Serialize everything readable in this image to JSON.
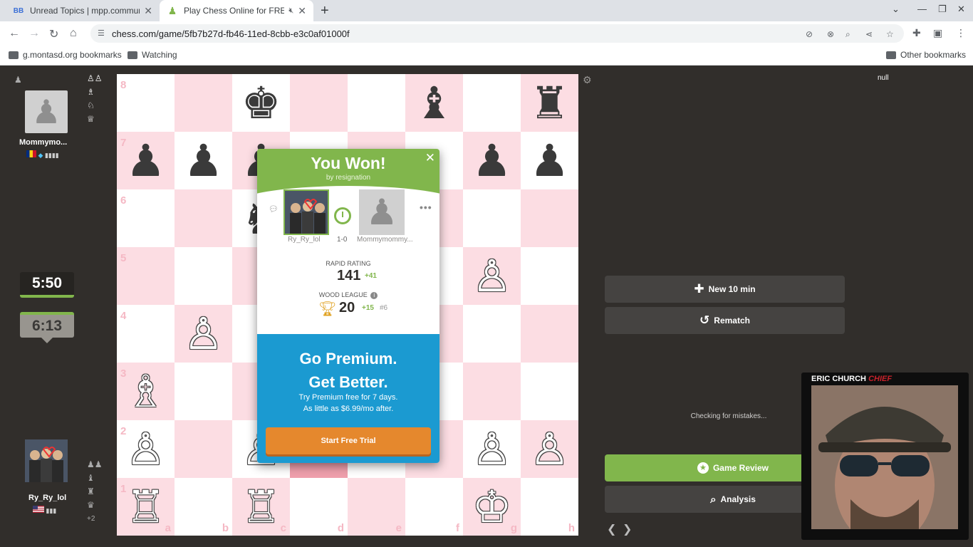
{
  "browser": {
    "tabs": [
      {
        "title": "Unread Topics | mpp.community",
        "favicon": "BB"
      },
      {
        "title": "Play Chess Online for FREE"
      }
    ],
    "url": "chess.com/game/5fb7b27d-fb46-11ed-8cbb-e3c0af01000f",
    "bookmarks": [
      "g.montasd.org bookmarks",
      "Watching"
    ],
    "other_bookmarks": "Other bookmarks"
  },
  "players": {
    "top": {
      "name": "Mommymo...",
      "clock": "5:50",
      "badges": "▮▮▮▮"
    },
    "bottom": {
      "name": "Ry_Ry_lol",
      "clock": "6:13",
      "captured_extra": "+2",
      "badges": "▮▮▮"
    }
  },
  "board": {
    "ranks": [
      "8",
      "7",
      "6",
      "5",
      "4",
      "3",
      "2",
      "1"
    ],
    "files": [
      "a",
      "b",
      "c",
      "d",
      "e",
      "f",
      "g",
      "h"
    ],
    "pieces": [
      {
        "sq": "c8",
        "p": "♚",
        "c": "b"
      },
      {
        "sq": "f8",
        "p": "♝",
        "c": "b"
      },
      {
        "sq": "h8",
        "p": "♜",
        "c": "b"
      },
      {
        "sq": "a7",
        "p": "♟",
        "c": "b"
      },
      {
        "sq": "b7",
        "p": "♟",
        "c": "b"
      },
      {
        "sq": "c7",
        "p": "♟",
        "c": "b"
      },
      {
        "sq": "g7",
        "p": "♟",
        "c": "b"
      },
      {
        "sq": "h7",
        "p": "♟",
        "c": "b"
      },
      {
        "sq": "c6",
        "p": "♞",
        "c": "b"
      },
      {
        "sq": "g5",
        "p": "♙",
        "c": "w"
      },
      {
        "sq": "b4",
        "p": "♙",
        "c": "w"
      },
      {
        "sq": "a3",
        "p": "♗",
        "c": "w"
      },
      {
        "sq": "a2",
        "p": "♙",
        "c": "w"
      },
      {
        "sq": "c2",
        "p": "♙",
        "c": "w"
      },
      {
        "sq": "g2",
        "p": "♙",
        "c": "w"
      },
      {
        "sq": "h2",
        "p": "♙",
        "c": "w"
      },
      {
        "sq": "a1",
        "p": "♖",
        "c": "w"
      },
      {
        "sq": "c1",
        "p": "♖",
        "c": "w"
      },
      {
        "sq": "g1",
        "p": "♔",
        "c": "w"
      }
    ],
    "highlight": [
      "d2"
    ]
  },
  "modal": {
    "title": "You Won!",
    "reason": "by resignation",
    "winner": "Ry_Ry_lol",
    "loser": "Mommymommy...",
    "score": "1-0",
    "rating_label": "RAPID RATING",
    "rating": "141",
    "rating_delta": "+41",
    "league_label": "WOOD LEAGUE",
    "league_points": "20",
    "league_delta": "+15",
    "league_rank": "#6",
    "promo_line1": "Go Premium.",
    "promo_line2": "Get Better.",
    "promo_line3": "Try Premium free for 7 days.",
    "promo_line4": "As little as $6.99/mo after.",
    "trial_button": "Start Free Trial"
  },
  "right": {
    "null_text": "null",
    "new_game": "New 10 min",
    "rematch": "Rematch",
    "checking": "Checking for mistakes...",
    "game_review": "Game Review",
    "analysis": "Analysis"
  },
  "album": {
    "artist": "ERIC CHURCH",
    "title": "CHIEF"
  },
  "colors": {
    "green": "#81b64c",
    "blue": "#1b9ad1",
    "orange": "#e5882d",
    "board_dark": "#fcdde3"
  }
}
